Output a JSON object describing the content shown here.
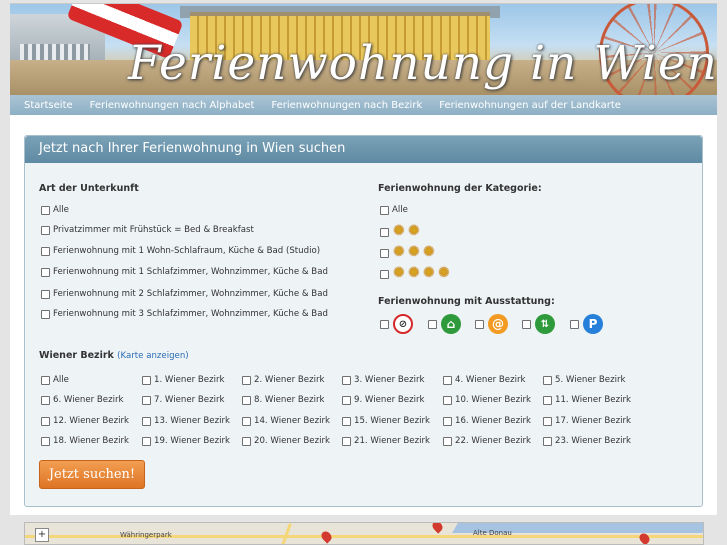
{
  "header": {
    "title": "Ferienwohnung in Wien"
  },
  "nav": {
    "items": [
      {
        "label": "Startseite"
      },
      {
        "label": "Ferienwohnungen nach Alphabet"
      },
      {
        "label": "Ferienwohnungen nach Bezirk"
      },
      {
        "label": "Ferienwohnungen auf der Landkarte"
      }
    ]
  },
  "search_panel": {
    "title": "Jetzt nach Ihrer Ferienwohnung in Wien suchen",
    "accommodation": {
      "heading": "Art der Unterkunft",
      "options": [
        "Alle",
        "Privatzimmer mit Frühstück = Bed & Breakfast",
        "Ferienwohnung mit 1 Wohn-Schlafraum, Küche & Bad (Studio)",
        "Ferienwohnung mit 1 Schlafzimmer, Wohnzimmer, Küche & Bad",
        "Ferienwohnung mit 2 Schlafzimmer, Wohnzimmer, Küche & Bad",
        "Ferienwohnung mit 3 Schlafzimmer, Wohnzimmer, Küche & Bad"
      ]
    },
    "category": {
      "heading": "Ferienwohnung der Kategorie:",
      "all_label": "Alle",
      "star_levels": [
        2,
        3,
        4
      ]
    },
    "amenities": {
      "heading": "Ferienwohnung mit Ausstattung:",
      "icons": [
        "no-smoking-icon",
        "house-icon",
        "internet-at-icon",
        "elevator-icon",
        "parking-icon"
      ]
    },
    "districts": {
      "heading": "Wiener Bezirk",
      "map_link": "(Karte anzeigen)",
      "options": [
        "Alle",
        "1. Wiener Bezirk",
        "2. Wiener Bezirk",
        "3. Wiener Bezirk",
        "4. Wiener Bezirk",
        "5. Wiener Bezirk",
        "6. Wiener Bezirk",
        "7. Wiener Bezirk",
        "8. Wiener Bezirk",
        "9. Wiener Bezirk",
        "10. Wiener Bezirk",
        "11. Wiener Bezirk",
        "12. Wiener Bezirk",
        "13. Wiener Bezirk",
        "14. Wiener Bezirk",
        "15. Wiener Bezirk",
        "16. Wiener Bezirk",
        "17. Wiener Bezirk",
        "18. Wiener Bezirk",
        "19. Wiener Bezirk",
        "20. Wiener Bezirk",
        "21. Wiener Bezirk",
        "22. Wiener Bezirk",
        "23. Wiener Bezirk"
      ]
    },
    "submit_label": "Jetzt suchen!"
  },
  "map": {
    "labels": [
      "Währingerpark",
      "Alte Donau"
    ],
    "zoom_in": "+"
  }
}
